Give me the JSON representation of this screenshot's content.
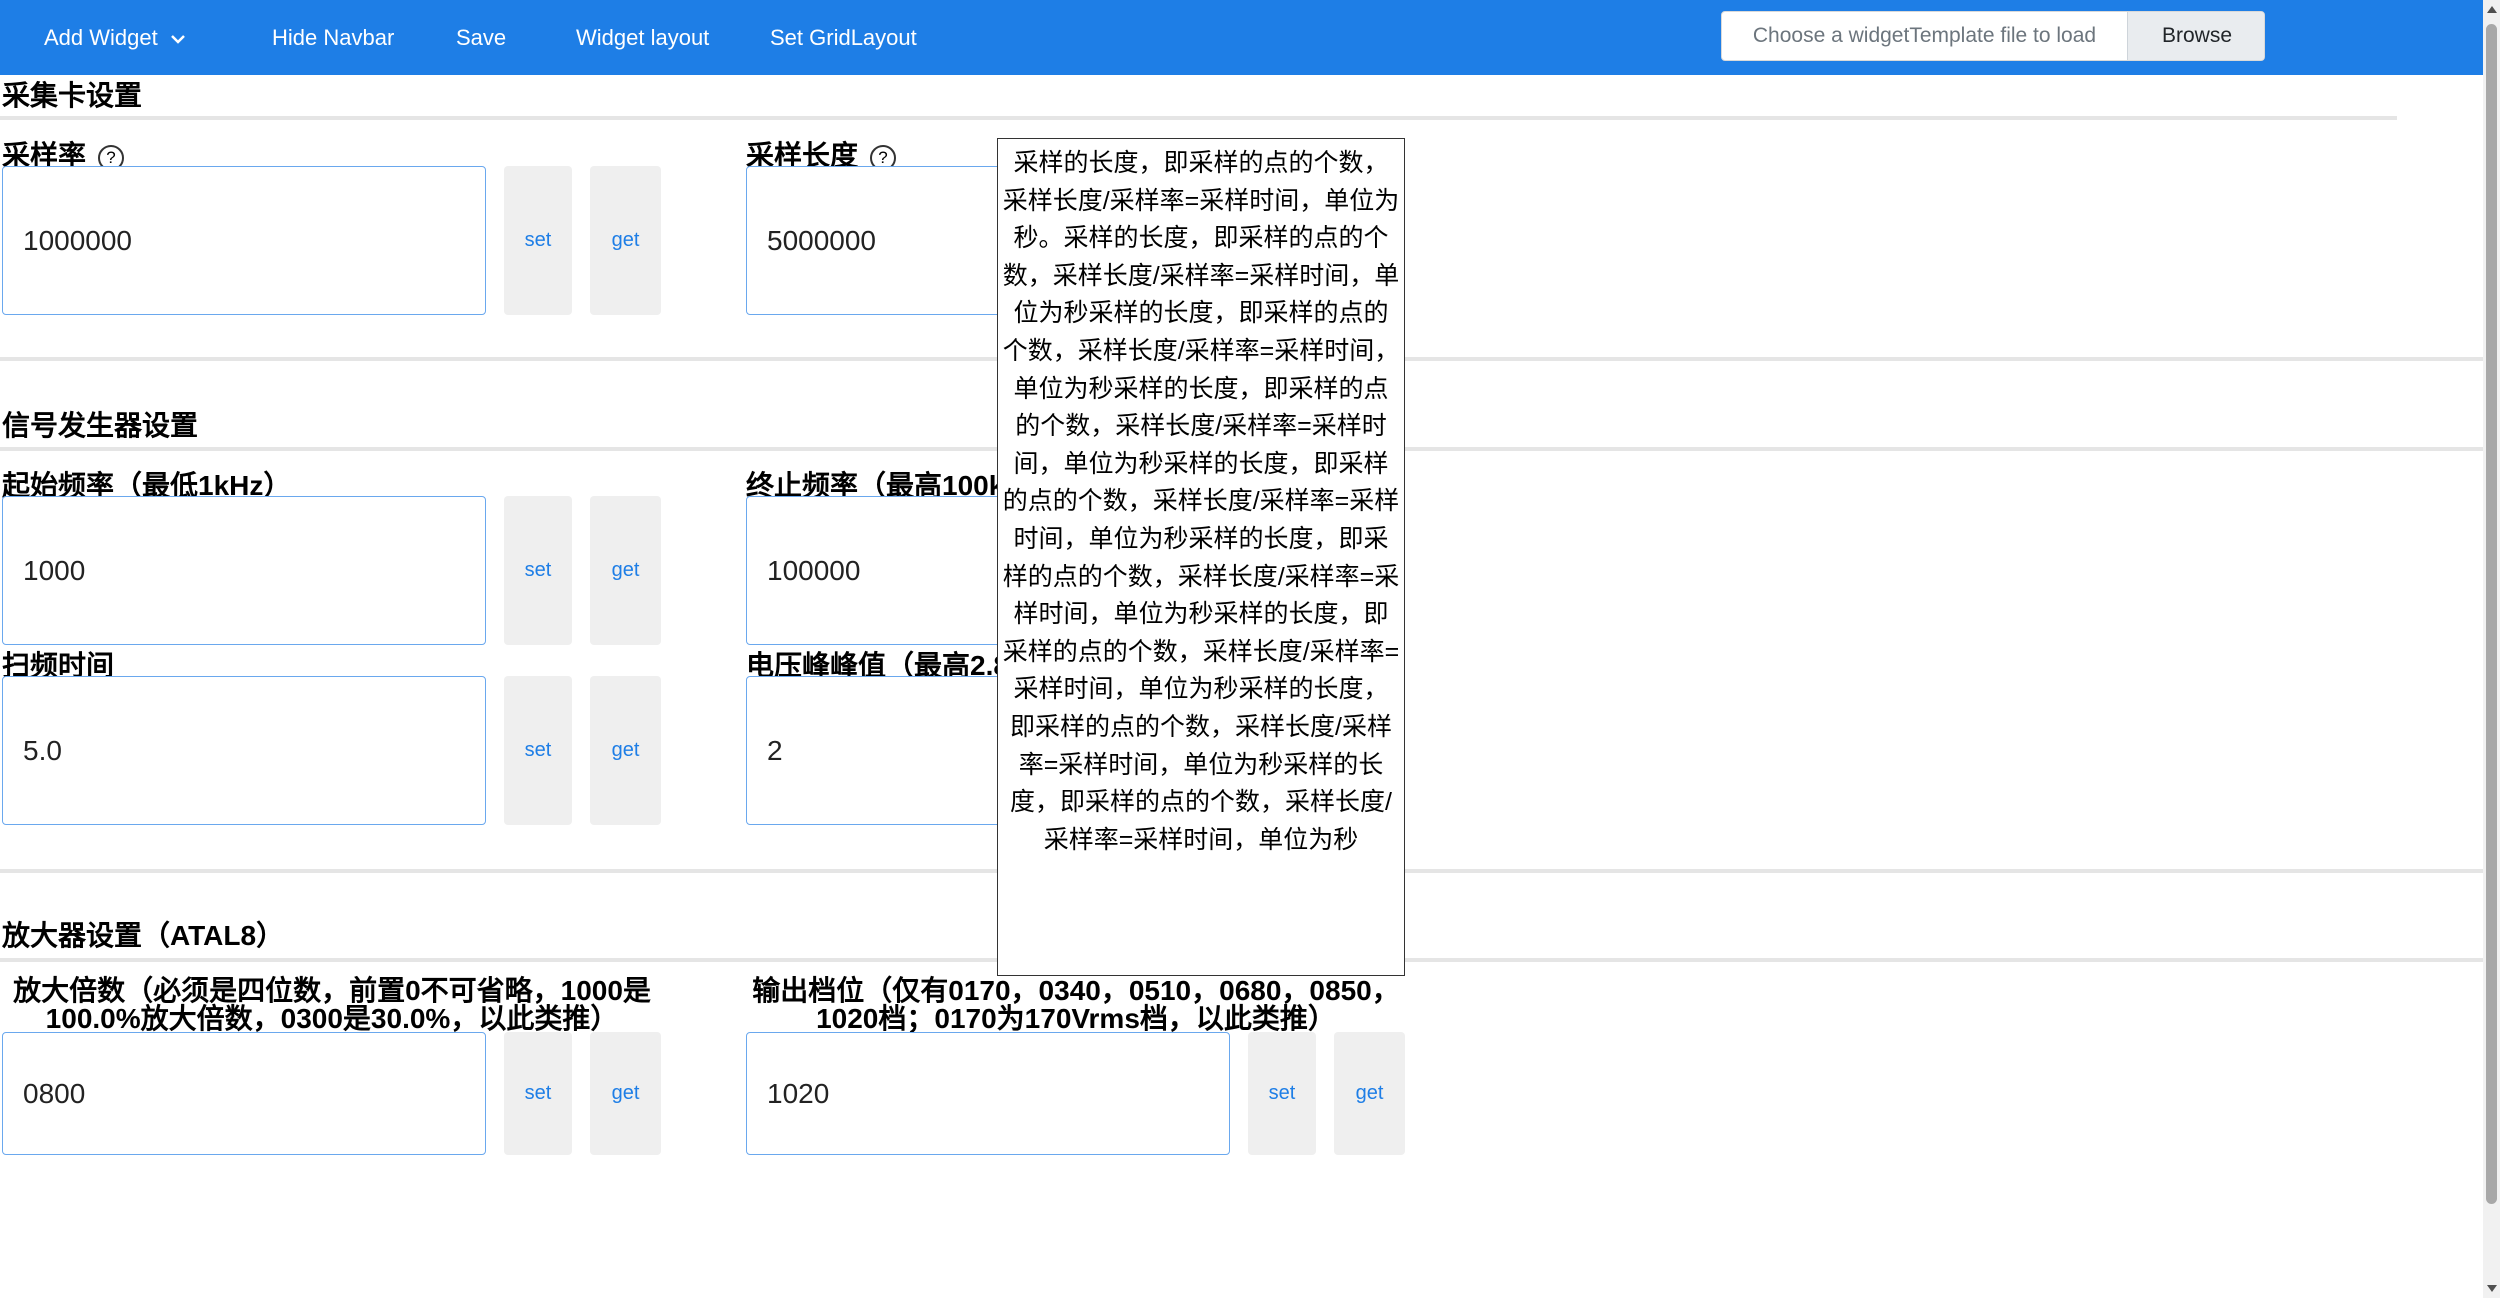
{
  "navbar": {
    "add_widget": "Add Widget",
    "hide_navbar": "Hide Navbar",
    "save": "Save",
    "widget_layout": "Widget layout",
    "set_grid_layout": "Set GridLayout",
    "file_placeholder": "Choose a widgetTemplate file to load",
    "browse": "Browse"
  },
  "sections": {
    "acquisition": {
      "title": "采集卡设置",
      "sample_rate": {
        "label": "采样率",
        "value": "1000000"
      },
      "sample_length": {
        "label": "采样长度",
        "value": "5000000"
      }
    },
    "signal": {
      "title": "信号发生器设置",
      "start_freq": {
        "label": "起始频率（最低1kHz）",
        "value": "1000"
      },
      "stop_freq": {
        "label": "终止频率（最高100k",
        "value": "100000"
      },
      "sweep_time": {
        "label": "扫频时间",
        "value": "5.0"
      },
      "voltage": {
        "label": "电压峰峰值（最高2.8",
        "value": "2"
      }
    },
    "amplifier": {
      "title": "放大器设置（ATAL8）",
      "gain": {
        "label": "放大倍数（必须是四位数，前置0不可省略，1000是100.0%放大倍数，0300是30.0%，以此类推）",
        "value": "0800"
      },
      "range": {
        "label": "输出档位（仅有0170，0340，0510，0680，0850，1020档；0170为170Vrms档，以此类推）",
        "value": "1020"
      }
    }
  },
  "buttons": {
    "set": "set",
    "get": "get"
  },
  "help_glyph": "?",
  "tooltip": "采样的长度，即采样的点的个数，采样长度/采样率=采样时间，单位为秒。采样的长度，即采样的点的个数，采样长度/采样率=采样时间，单位为秒采样的长度，即采样的点的个数，采样长度/采样率=采样时间，单位为秒采样的长度，即采样的点的个数，采样长度/采样率=采样时间，单位为秒采样的长度，即采样的点的个数，采样长度/采样率=采样时间，单位为秒采样的长度，即采样的点的个数，采样长度/采样率=采样时间，单位为秒采样的长度，即采样的点的个数，采样长度/采样率=采样时间，单位为秒采样的长度，即采样的点的个数，采样长度/采样率=采样时间，单位为秒采样的长度，即采样的点的个数，采样长度/采样率=采样时间，单位为秒",
  "colors": {
    "navbar": "#1e7ee6",
    "input_border": "#6aa8ee",
    "button_text": "#1e7ee6"
  }
}
